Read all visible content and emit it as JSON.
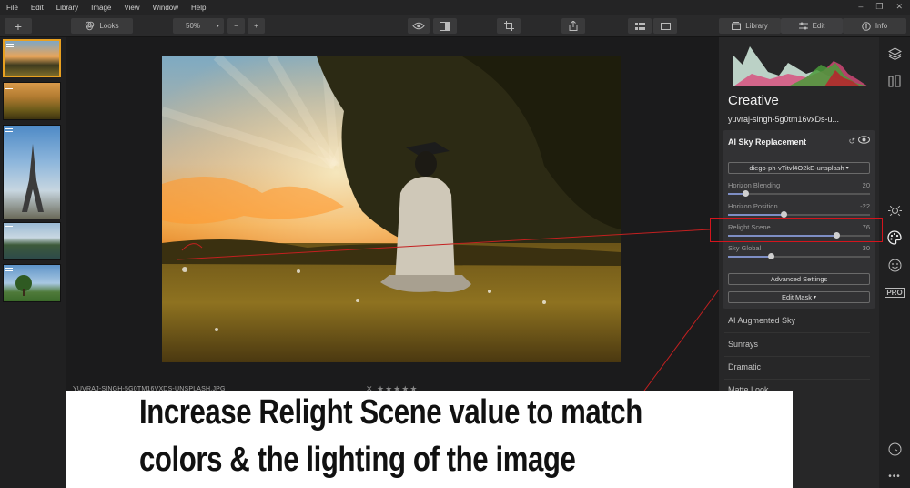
{
  "menubar": {
    "items": [
      "File",
      "Edit",
      "Library",
      "Image",
      "View",
      "Window",
      "Help"
    ]
  },
  "toolbar": {
    "looks_label": "Looks",
    "zoom_value": "50%",
    "zoom_out_symbol": "−",
    "zoom_in_symbol": "+",
    "add_symbol": "+",
    "tabs": {
      "library": "Library",
      "edit": "Edit",
      "info": "Info"
    }
  },
  "canvas": {
    "filename": "YUVRAJ-SINGH-5G0TM16VXDS-UNSPLASH.JPG",
    "rating_stars": "✕ ★★★★★"
  },
  "panel": {
    "title": "Creative",
    "file": "yuvraj-singh-5g0tm16vxDs-u...",
    "sky_card": {
      "title": "AI Sky Replacement",
      "sky_selected": "diego-ph-vTitvl4O2kE-unsplash",
      "sliders": [
        {
          "label": "Horizon Blending",
          "value": "20",
          "fraction": 0.12
        },
        {
          "label": "Horizon Position",
          "value": "-22",
          "fraction": 0.39
        },
        {
          "label": "Relight Scene",
          "value": "76",
          "fraction": 0.76
        },
        {
          "label": "Sky Global",
          "value": "30",
          "fraction": 0.3
        }
      ],
      "advanced_label": "Advanced Settings",
      "edit_mask_label": "Edit Mask"
    },
    "filters": [
      "AI Augmented Sky",
      "Sunrays",
      "Dramatic",
      "Matte Look"
    ]
  },
  "rail": {
    "pro_label": "PRO"
  },
  "caption": {
    "line1": "Increase Relight Scene value to match",
    "line2": "colors & the lighting of the image"
  },
  "colors": {
    "accent": "#e8a020",
    "highlight": "#d4151d",
    "slider_fill": "#7e8ec4"
  }
}
